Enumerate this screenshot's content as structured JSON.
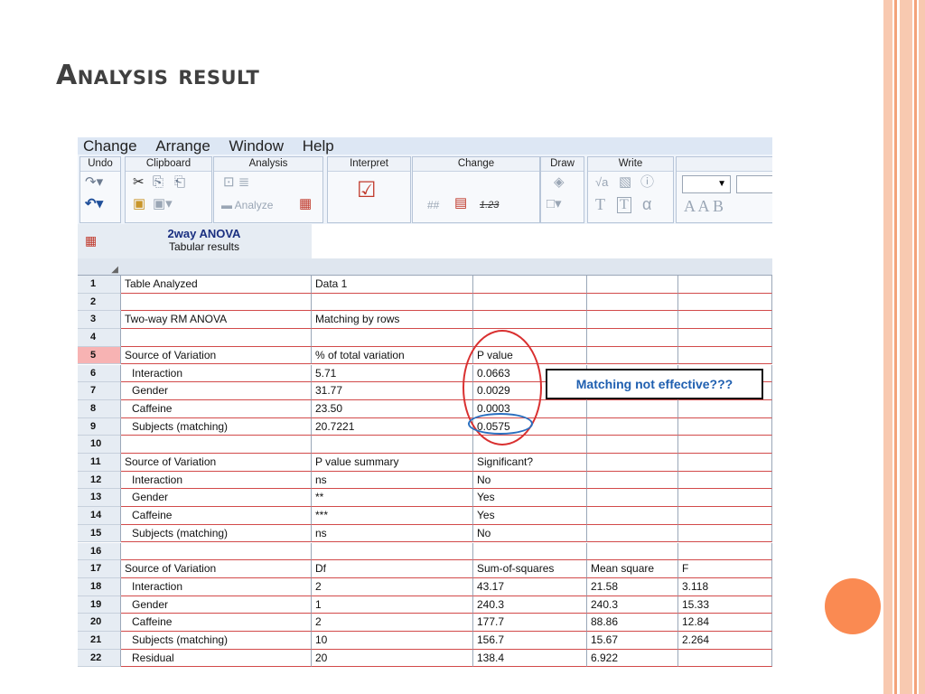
{
  "slide": {
    "title": "Analysis result",
    "accent_color": "#fa8a52"
  },
  "menu": [
    "Change",
    "Arrange",
    "Window",
    "Help"
  ],
  "ribbon": {
    "groups": [
      "Undo",
      "Clipboard",
      "Analysis",
      "Interpret",
      "Change",
      "Draw",
      "Write"
    ],
    "analyze_label": "Analyze",
    "number_format": "1.23",
    "symbols": {
      "sqrt": "√a",
      "alpha": "α",
      "text_t": "T",
      "text_boxed": "T",
      "font_letters": "A A B"
    }
  },
  "sheet": {
    "title": "2way ANOVA",
    "subtitle": "Tabular results"
  },
  "rows": [
    {
      "n": "1",
      "c": [
        "Table Analyzed",
        "Data 1",
        "",
        "",
        ""
      ]
    },
    {
      "n": "2",
      "c": [
        "",
        "",
        "",
        "",
        ""
      ]
    },
    {
      "n": "3",
      "c": [
        "Two-way RM ANOVA",
        "Matching by rows",
        "",
        "",
        ""
      ]
    },
    {
      "n": "4",
      "c": [
        "",
        "",
        "",
        "",
        ""
      ]
    },
    {
      "n": "5",
      "c": [
        "Source of Variation",
        "% of total variation",
        "P value",
        "",
        ""
      ]
    },
    {
      "n": "6",
      "c": [
        "Interaction",
        "5.71",
        "0.0663",
        "",
        ""
      ]
    },
    {
      "n": "7",
      "c": [
        "Gender",
        "31.77",
        "0.0029",
        "",
        ""
      ]
    },
    {
      "n": "8",
      "c": [
        "Caffeine",
        "23.50",
        "0.0003",
        "",
        ""
      ]
    },
    {
      "n": "9",
      "c": [
        "Subjects (matching)",
        "20.7221",
        "0.0575",
        "",
        ""
      ]
    },
    {
      "n": "10",
      "c": [
        "",
        "",
        "",
        "",
        ""
      ]
    },
    {
      "n": "11",
      "c": [
        "Source of Variation",
        "P value summary",
        "Significant?",
        "",
        ""
      ]
    },
    {
      "n": "12",
      "c": [
        "Interaction",
        "ns",
        "No",
        "",
        ""
      ]
    },
    {
      "n": "13",
      "c": [
        "Gender",
        "**",
        "Yes",
        "",
        ""
      ]
    },
    {
      "n": "14",
      "c": [
        "Caffeine",
        "***",
        "Yes",
        "",
        ""
      ]
    },
    {
      "n": "15",
      "c": [
        "Subjects (matching)",
        "ns",
        "No",
        "",
        ""
      ]
    },
    {
      "n": "16",
      "c": [
        "",
        "",
        "",
        "",
        ""
      ]
    },
    {
      "n": "17",
      "c": [
        "Source of Variation",
        "Df",
        "Sum-of-squares",
        "Mean square",
        "F"
      ]
    },
    {
      "n": "18",
      "c": [
        "Interaction",
        "2",
        "43.17",
        "21.58",
        "3.118"
      ]
    },
    {
      "n": "19",
      "c": [
        "Gender",
        "1",
        "240.3",
        "240.3",
        "15.33"
      ]
    },
    {
      "n": "20",
      "c": [
        "Caffeine",
        "2",
        "177.7",
        "88.86",
        "12.84"
      ]
    },
    {
      "n": "21",
      "c": [
        "Subjects (matching)",
        "10",
        "156.7",
        "15.67",
        "2.264"
      ]
    },
    {
      "n": "22",
      "c": [
        "Residual",
        "20",
        "138.4",
        "6.922",
        ""
      ]
    }
  ],
  "selected_row": "5",
  "annotation": {
    "callout": "Matching not effective???"
  }
}
